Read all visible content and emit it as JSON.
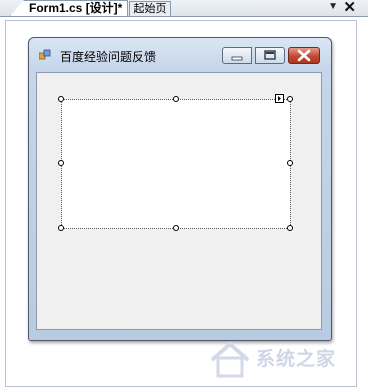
{
  "tabs": {
    "active": "Form1.cs [设计]*",
    "inactive": "起始页",
    "dropdown_icon": "▼",
    "close_icon": "✕"
  },
  "form": {
    "title": "百度经验问题反馈",
    "minimize_icon": "minimize",
    "maximize_icon": "maximize",
    "close_icon": "close"
  },
  "watermark": {
    "text": "系统之家"
  },
  "colors": {
    "close_red": "#c14a35",
    "titlebar_blue": "#c6d6ea",
    "client_bg": "#f0f0f0"
  }
}
